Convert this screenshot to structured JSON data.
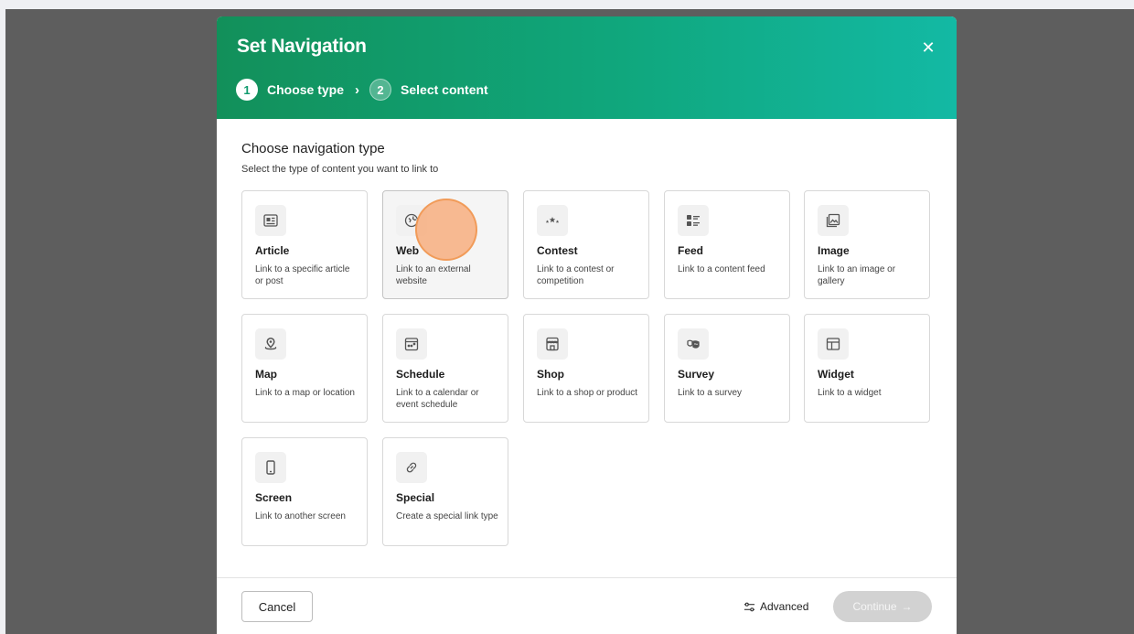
{
  "modal": {
    "title": "Set Navigation",
    "close_glyph": "✕",
    "steps": [
      {
        "number": "1",
        "label": "Choose type",
        "active": true
      },
      {
        "number": "2",
        "label": "Select content",
        "active": false
      }
    ],
    "step_separator": "›"
  },
  "section": {
    "title": "Choose navigation type",
    "subtitle": "Select the type of content you want to link to"
  },
  "cards": [
    {
      "title": "Article",
      "desc": "Link to a specific article or post",
      "icon": "article-icon"
    },
    {
      "title": "Web",
      "desc": "Link to an external website",
      "icon": "globe-icon",
      "selected": true
    },
    {
      "title": "Contest",
      "desc": "Link to a contest or competition",
      "icon": "stars-icon"
    },
    {
      "title": "Feed",
      "desc": "Link to a content feed",
      "icon": "feed-icon"
    },
    {
      "title": "Image",
      "desc": "Link to an image or gallery",
      "icon": "image-icon"
    },
    {
      "title": "Map",
      "desc": "Link to a map or location",
      "icon": "map-pin-icon"
    },
    {
      "title": "Schedule",
      "desc": "Link to a calendar or event schedule",
      "icon": "calendar-icon"
    },
    {
      "title": "Shop",
      "desc": "Link to a shop or product",
      "icon": "shop-icon"
    },
    {
      "title": "Survey",
      "desc": "Link to a survey",
      "icon": "survey-icon"
    },
    {
      "title": "Widget",
      "desc": "Link to a widget",
      "icon": "widget-icon"
    },
    {
      "title": "Screen",
      "desc": "Link to another screen",
      "icon": "phone-icon"
    },
    {
      "title": "Special",
      "desc": "Create a special link type",
      "icon": "link-icon"
    }
  ],
  "footer": {
    "cancel_label": "Cancel",
    "advanced_label": "Advanced",
    "continue_label": "Continue",
    "continue_arrow": "→"
  },
  "colors": {
    "header_start": "#12905a",
    "header_end": "#13b9a4",
    "backdrop": "#5e5e5e",
    "continue_disabled": "#d2d2d2",
    "click_indicator": "#f8aa78"
  }
}
